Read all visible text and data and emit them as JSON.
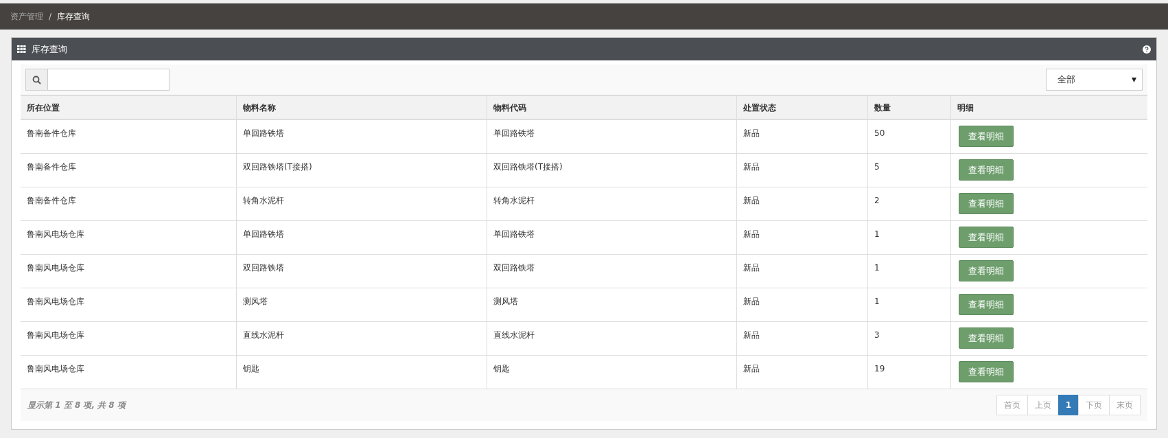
{
  "breadcrumb": [
    {
      "label": "资产管理",
      "current": false
    },
    {
      "label": "库存查询",
      "current": true
    }
  ],
  "breadcrumb_separator": "/",
  "panel": {
    "title": "库存查询"
  },
  "filter": {
    "value": "全部"
  },
  "table": {
    "columns": [
      "所在位置",
      "物料名称",
      "物料代码",
      "处置状态",
      "数量",
      "明细"
    ],
    "rows": [
      {
        "location": "鲁南备件仓库",
        "name": "单回路铁塔",
        "code": "单回路铁塔",
        "status": "新品",
        "qty": "50",
        "action": "查看明细"
      },
      {
        "location": "鲁南备件仓库",
        "name": "双回路铁塔(T接搭)",
        "code": "双回路铁塔(T接搭)",
        "status": "新品",
        "qty": "5",
        "action": "查看明细"
      },
      {
        "location": "鲁南备件仓库",
        "name": "转角水泥杆",
        "code": "转角水泥杆",
        "status": "新品",
        "qty": "2",
        "action": "查看明细"
      },
      {
        "location": "鲁南风电场仓库",
        "name": "单回路铁塔",
        "code": "单回路铁塔",
        "status": "新品",
        "qty": "1",
        "action": "查看明细"
      },
      {
        "location": "鲁南风电场仓库",
        "name": "双回路铁塔",
        "code": "双回路铁塔",
        "status": "新品",
        "qty": "1",
        "action": "查看明细"
      },
      {
        "location": "鲁南风电场仓库",
        "name": "测风塔",
        "code": "测风塔",
        "status": "新品",
        "qty": "1",
        "action": "查看明细"
      },
      {
        "location": "鲁南风电场仓库",
        "name": "直线水泥杆",
        "code": "直线水泥杆",
        "status": "新品",
        "qty": "3",
        "action": "查看明细"
      },
      {
        "location": "鲁南风电场仓库",
        "name": "钥匙",
        "code": "钥匙",
        "status": "新品",
        "qty": "19",
        "action": "查看明细"
      }
    ]
  },
  "info": "显示第 1 至 8 项, 共 8 项",
  "pagination": [
    {
      "label": "首页",
      "selected": false
    },
    {
      "label": "上页",
      "selected": false
    },
    {
      "label": "1",
      "selected": true
    },
    {
      "label": "下页",
      "selected": false
    },
    {
      "label": "末页",
      "selected": false
    }
  ]
}
